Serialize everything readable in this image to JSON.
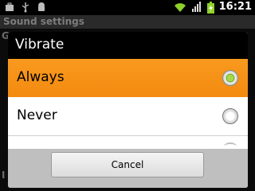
{
  "status_bar": {
    "time": "16:21",
    "left_icons": [
      "briefcase-icon",
      "usb-icon",
      "android-debug-icon"
    ],
    "right_icons": [
      "wifi-icon",
      "signal-icon",
      "battery-icon"
    ]
  },
  "background_screen": {
    "title": "Sound settings",
    "partial_text_top": "G",
    "partial_text_bottom": "I"
  },
  "dialog": {
    "title": "Vibrate",
    "options": [
      {
        "label": "Always",
        "selected": true
      },
      {
        "label": "Never",
        "selected": false
      }
    ],
    "cancel_label": "Cancel"
  },
  "colors": {
    "selected_row": "#f28a10",
    "radio_checked": "#8fc93a"
  }
}
